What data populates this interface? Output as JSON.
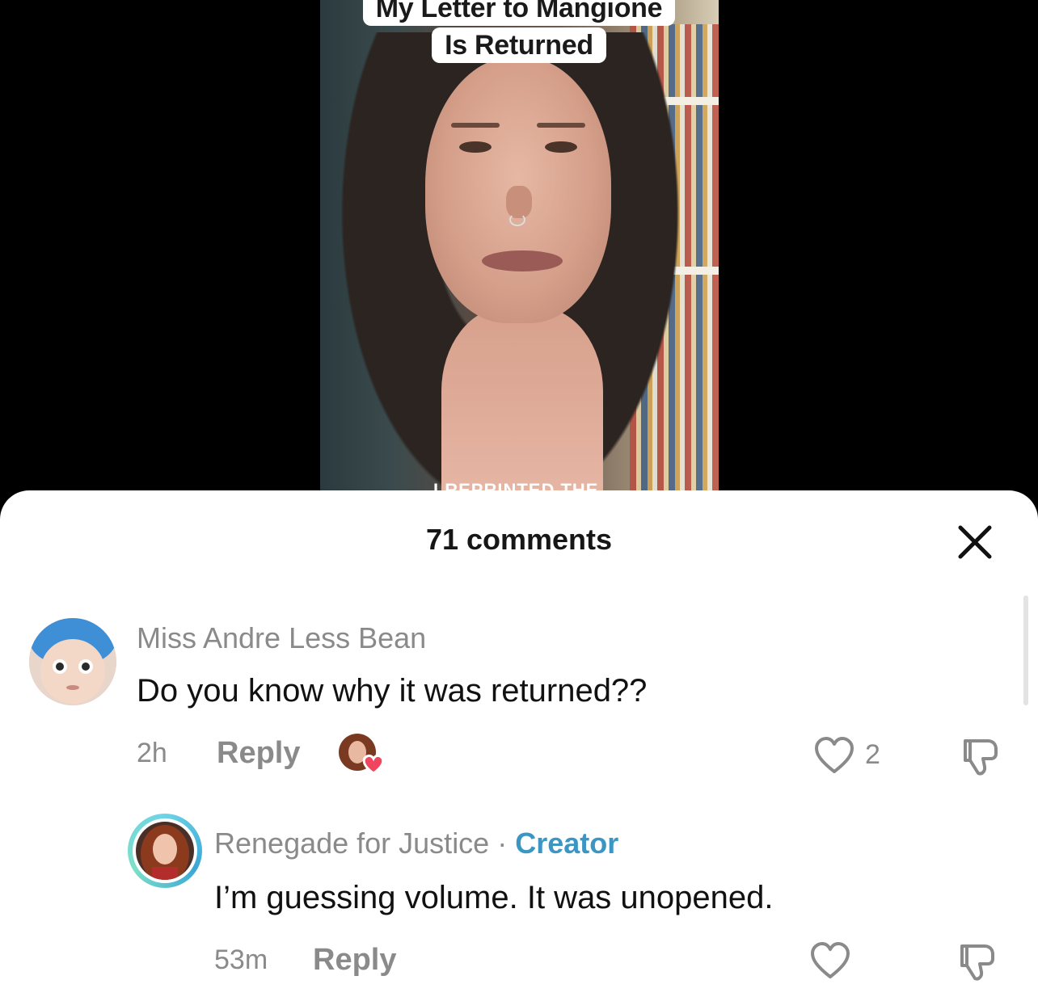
{
  "video": {
    "caption_line1": "My Letter to Mangione",
    "caption_line2": "Is Returned",
    "subtitle": "I REPRINTED THE"
  },
  "comments_panel": {
    "title": "71 comments",
    "comments": [
      {
        "username": "Miss Andre Less Bean",
        "text": "Do you know why it was returned??",
        "time": "2h",
        "reply_label": "Reply",
        "likes": "2",
        "creator_liked": true
      },
      {
        "username": "Renegade for Justice",
        "separator": "·",
        "badge": "Creator",
        "text": "I’m guessing volume. It was unopened.",
        "time": "53m",
        "reply_label": "Reply"
      }
    ]
  },
  "colors": {
    "creator_badge": "#3b96c4",
    "heart_badge": "#f0455e",
    "muted_text": "#8a8a8a"
  },
  "icons": [
    "close-icon",
    "heart-outline-icon",
    "dislike-icon",
    "heart-badge-icon"
  ]
}
